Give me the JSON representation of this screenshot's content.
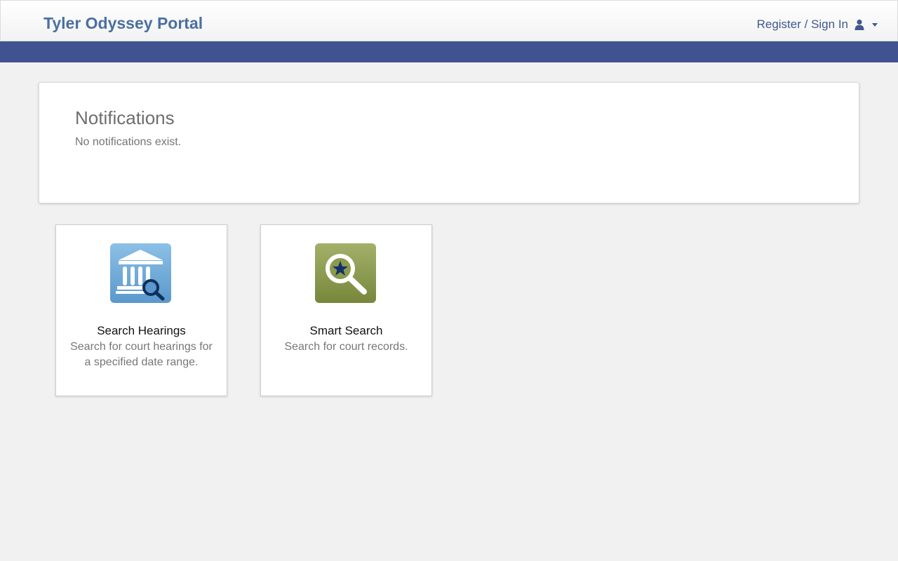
{
  "header": {
    "brand": "Tyler Odyssey Portal",
    "user_menu_label": "Register / Sign In",
    "user_icon": "user-icon",
    "caret_icon": "caret-down-icon"
  },
  "colors": {
    "brand_text": "#4a6fa1",
    "accent_bar": "#40528f",
    "hearings_icon_bg": "#6ea6d3",
    "smart_search_icon_bg": "#8a9a4e"
  },
  "notifications": {
    "title": "Notifications",
    "message": "No notifications exist."
  },
  "tiles": [
    {
      "icon": "courthouse-search-icon",
      "title": "Search Hearings",
      "description": "Search for court hearings for a specified date range."
    },
    {
      "icon": "magnifier-star-icon",
      "title": "Smart Search",
      "description": "Search for court records."
    }
  ]
}
